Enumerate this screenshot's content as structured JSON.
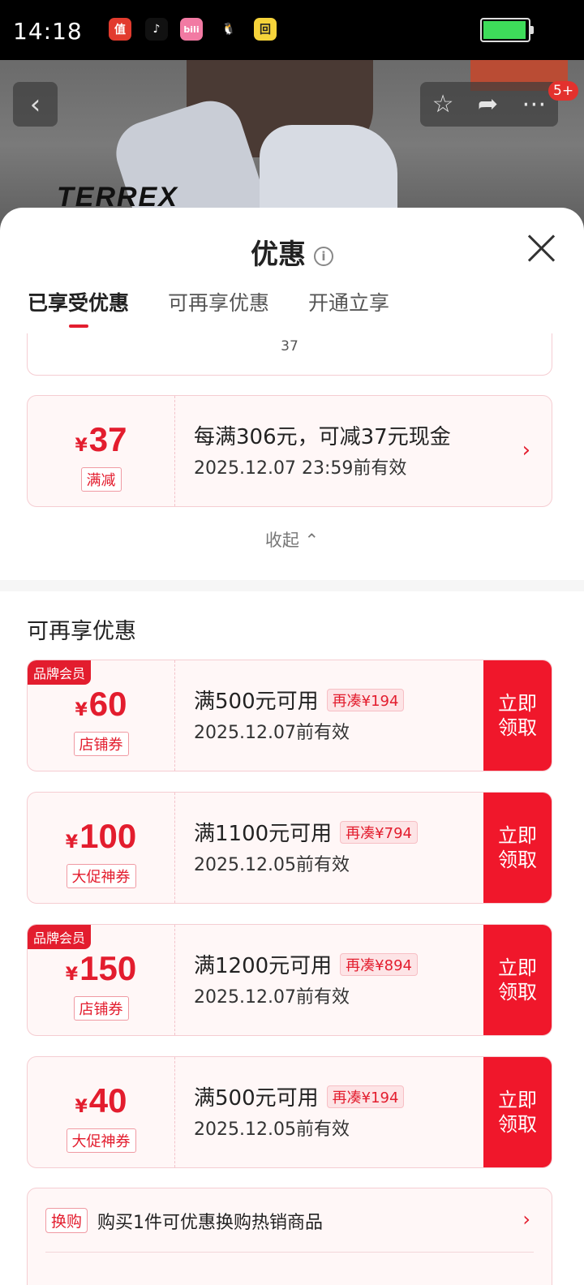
{
  "status_bar": {
    "time": "14:18",
    "apps": [
      {
        "icon": "zhi-icon",
        "glyph": "值",
        "bg": "#e23b2e",
        "fg": "#ffffff"
      },
      {
        "icon": "tiktok-icon",
        "glyph": "♪",
        "bg": "#111111",
        "fg": "#ffffff"
      },
      {
        "icon": "bilibili-icon",
        "glyph": "bili",
        "bg": "#f27aa3",
        "fg": "#ffffff"
      },
      {
        "icon": "qq-icon",
        "glyph": "🐧",
        "bg": "#000000",
        "fg": "#5bc0f5"
      },
      {
        "icon": "app-yellow-icon",
        "glyph": "回",
        "bg": "#f5d33a",
        "fg": "#222222"
      }
    ]
  },
  "top_nav": {
    "brand_text": "TERREX",
    "badge": "5+"
  },
  "sheet": {
    "title": "优惠",
    "tabs": [
      {
        "label": "已享受优惠",
        "active": true
      },
      {
        "label": "可再享优惠",
        "active": false
      },
      {
        "label": "开通立享",
        "active": false
      }
    ],
    "partial_card_text": "37",
    "applied_coupon": {
      "yen": "¥",
      "amount": "37",
      "type": "满减",
      "condition": "每满306元，可减37元现金",
      "valid": "2025.12.07 23:59前有效"
    },
    "collapse_label": "收起"
  },
  "more_section": {
    "title": "可再享优惠",
    "coupons": [
      {
        "brand_tag": "品牌会员",
        "yen": "¥",
        "amount": "60",
        "type": "店铺券",
        "condition": "满500元可用",
        "extra": "再凑¥194",
        "valid": "2025.12.07前有效",
        "claim": "立即\n领取"
      },
      {
        "brand_tag": "",
        "yen": "¥",
        "amount": "100",
        "type": "大促神券",
        "condition": "满1100元可用",
        "extra": "再凑¥794",
        "valid": "2025.12.05前有效",
        "claim": "立即\n领取"
      },
      {
        "brand_tag": "品牌会员",
        "yen": "¥",
        "amount": "150",
        "type": "店铺券",
        "condition": "满1200元可用",
        "extra": "再凑¥894",
        "valid": "2025.12.07前有效",
        "claim": "立即\n领取"
      },
      {
        "brand_tag": "",
        "yen": "¥",
        "amount": "40",
        "type": "大促神券",
        "condition": "满500元可用",
        "extra": "再凑¥194",
        "valid": "2025.12.05前有效",
        "claim": "立即\n领取"
      }
    ],
    "swap": {
      "tag": "换购",
      "text": "购买1件可优惠换购热销商品"
    }
  },
  "colors": {
    "accent": "#e31d2e",
    "claim_button": "#f0172b",
    "battery": "#3edc5a"
  }
}
